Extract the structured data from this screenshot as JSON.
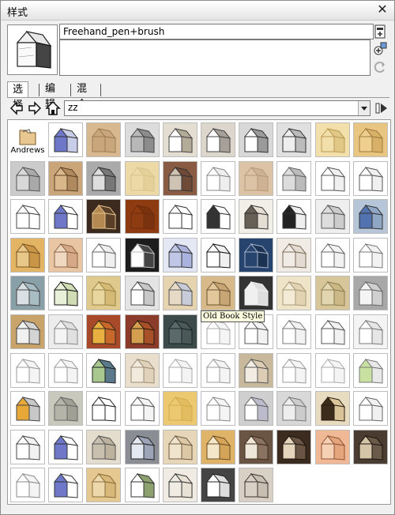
{
  "window": {
    "title": "样式",
    "close_glyph": "✕"
  },
  "style": {
    "name": "Freehand_pen+brush",
    "description": ""
  },
  "tabs": [
    {
      "label": "选择",
      "active": true
    },
    {
      "label": "编辑",
      "active": false
    },
    {
      "label": "混合",
      "active": false
    }
  ],
  "navigation": {
    "library": "zz"
  },
  "grid": {
    "columns": 10,
    "items": [
      {
        "kind": "folder",
        "label": "Andrews"
      },
      {
        "bg": "#ffffff",
        "house": "#6e77c8",
        "line": "#333333",
        "shade": "#c8cde8"
      },
      {
        "bg": "#d8b98f",
        "house": "#c9a77a",
        "line": "#9c7c56",
        "shade": "#c9a77a"
      },
      {
        "bg": "#dcdcdc",
        "house": "#b8b8b8",
        "line": "#444444",
        "shade": "#8c8c8c"
      },
      {
        "bg": "#e3ddd2",
        "house": "#ffffff",
        "line": "#444444",
        "shade": "#b4aa98"
      },
      {
        "bg": "#dcd6cc",
        "house": "#ffffff",
        "line": "#444444",
        "shade": "#a7a099"
      },
      {
        "bg": "#d8d8d8",
        "house": "#ffffff",
        "line": "#333333",
        "shade": "#9a9a9a"
      },
      {
        "bg": "#e0e0e0",
        "house": "#eeeeee",
        "line": "#333333",
        "shade": "#bbbbbb"
      },
      {
        "bg": "#f3dfa9",
        "house": "#f3dfa9",
        "line": "#b89a56",
        "shade": "#e2c886"
      },
      {
        "bg": "#e8c580",
        "house": "#efcf8f",
        "line": "#9c7a3c",
        "shade": "#d8b068"
      },
      {
        "bg": "#cbcbcb",
        "house": "#d8d8d8",
        "line": "#555555",
        "shade": "#a9a9a9"
      },
      {
        "bg": "#caa57a",
        "house": "#d9b78b",
        "line": "#5c4126",
        "shade": "#b08a5e"
      },
      {
        "bg": "#aaaaaa",
        "house": "#dddddd",
        "line": "#333333",
        "shade": "#777777"
      },
      {
        "bg": "#ecd9a6",
        "house": "#ecd9a6",
        "line": "#d8c48f",
        "shade": "#e4d098"
      },
      {
        "bg": "#8a5b43",
        "house": "#cfc3b3",
        "line": "#333333",
        "shade": "#6f4a37"
      },
      {
        "bg": "#ffffff",
        "house": "#ffffff",
        "line": "#888888",
        "shade": "#eeeeee"
      },
      {
        "bg": "#dcc3a5",
        "house": "#dcc3a5",
        "line": "#b89a7c",
        "shade": "#cdb293"
      },
      {
        "bg": "#ffffff",
        "house": "#dcdcdc",
        "line": "#666666",
        "shade": "#bbbbbb"
      },
      {
        "bg": "#ffffff",
        "house": "#ffffff",
        "line": "#555555",
        "shade": "#f0f0f0"
      },
      {
        "bg": "#ffffff",
        "house": "#ffffff",
        "line": "#555555",
        "shade": "#f0f0f0"
      },
      {
        "bg": "#ffffff",
        "house": "#ffffff",
        "line": "#444444",
        "shade": "#ffffff"
      },
      {
        "bg": "#ffffff",
        "house": "#6e77c8",
        "line": "#333333",
        "shade": "#ffffff"
      },
      {
        "bg": "#3b2a1d",
        "house": "#b58a52",
        "line": "#e0c08a",
        "shade": "#5a3f28"
      },
      {
        "bg": "#8f3b12",
        "house": "#8f3b12",
        "line": "#6e2c0c",
        "shade": "#7a320f"
      },
      {
        "bg": "#ffffff",
        "house": "#ffffff",
        "line": "#333333",
        "shade": "#ffffff"
      },
      {
        "bg": "#ffffff",
        "house": "#333333",
        "line": "#333333",
        "shade": "#ffffff"
      },
      {
        "bg": "#f2efe9",
        "house": "#665f55",
        "line": "#333333",
        "shade": "#e4ded2"
      },
      {
        "bg": "#ffffff",
        "house": "#222222",
        "line": "#333333",
        "shade": "#eeeeee"
      },
      {
        "bg": "#efefef",
        "house": "#dddddd",
        "line": "#555555",
        "shade": "#cccccc"
      },
      {
        "bg": "#b6c6d8",
        "house": "#5273b0",
        "line": "#333333",
        "shade": "#8fa6c4"
      },
      {
        "bg": "#e2b463",
        "house": "#e8c889",
        "line": "#7a5524",
        "shade": "#c99648"
      },
      {
        "bg": "#e9c5a4",
        "house": "#f0d7bf",
        "line": "#8c6547",
        "shade": "#d5a987"
      },
      {
        "bg": "#ffffff",
        "house": "#ffffff",
        "line": "#666666",
        "shade": "#f0f0f0"
      },
      {
        "bg": "#1c1c1c",
        "house": "#ffffff",
        "line": "#bbbbbb",
        "shade": "#444444"
      },
      {
        "bg": "#e4e8f4",
        "house": "#c0c7e6",
        "line": "#333333",
        "shade": "#aab3de"
      },
      {
        "bg": "#ffffff",
        "house": "#ffffff",
        "line": "#111111",
        "shade": "#f0f0f0"
      },
      {
        "bg": "#27446e",
        "house": "#27446e",
        "line": "#a8b4c8",
        "shade": "#1b3252"
      },
      {
        "bg": "#f0ebe4",
        "house": "#f0ebe4",
        "line": "#7a6a58",
        "shade": "#e4dcd2"
      },
      {
        "bg": "#ffffff",
        "house": "#ffffff",
        "line": "#666666",
        "shade": "#f2f2f2"
      },
      {
        "bg": "#ffffff",
        "house": "#ffffff",
        "line": "#777777",
        "shade": "#f2f2f2"
      },
      {
        "bg": "#8aa0a8",
        "house": "#d8e0e4",
        "line": "#444444",
        "shade": "#a8bcc4"
      },
      {
        "bg": "#ffffff",
        "house": "#e8f0d8",
        "line": "#111111",
        "shade": "#cfdcb4"
      },
      {
        "bg": "#e0c98c",
        "house": "#e8d69f",
        "line": "#9c8448",
        "shade": "#d4ba74"
      },
      {
        "bg": "#e4e4e4",
        "house": "#ffffff",
        "line": "#444444",
        "shade": "#c8c8c8"
      },
      {
        "bg": "#e6d4b0",
        "house": "#e6d9c6",
        "line": "#555555",
        "shade": "#c8ccd8"
      },
      {
        "bg": "#d8b98a",
        "house": "#e2c79a",
        "line": "#6c5434",
        "shade": "#c8a574"
      },
      {
        "bg": "#333333",
        "house": "#f0f0f0",
        "line": "#f0f0f0",
        "shade": "#dddddd"
      },
      {
        "bg": "#efe4c8",
        "house": "#f3ebd6",
        "line": "#a89878",
        "shade": "#e2d4b2"
      },
      {
        "bg": "#d6c69a",
        "house": "#e2d6b0",
        "line": "#8c7c50",
        "shade": "#cbb886"
      },
      {
        "bg": "#a8a8a8",
        "house": "#f4f4f4",
        "line": "#666666",
        "shade": "#d0d0d0"
      },
      {
        "bg": "#c8a46a",
        "house": "#f0f0f0",
        "line": "#444444",
        "shade": "#d4d4d4"
      },
      {
        "bg": "#ececec",
        "house": "#f4f4f4",
        "line": "#888888",
        "shade": "#e0e0e0"
      },
      {
        "bg": "#a84a2a",
        "house": "#e8b040",
        "line": "#3c2c1c",
        "shade": "#c8682a"
      },
      {
        "bg": "#8c3a2a",
        "house": "#d4a050",
        "line": "#2c1c10",
        "shade": "#a85028"
      },
      {
        "bg": "#3c4a4a",
        "house": "#5a6a6a",
        "line": "#1c2424",
        "shade": "#4a5858"
      },
      {
        "bg": "#ffffff",
        "house": "#ffffff",
        "line": "#aaaaaa",
        "shade": "#f4f4f4"
      },
      {
        "bg": "#ffffff",
        "house": "#ffffff",
        "line": "#555555",
        "shade": "#f2f2f2"
      },
      {
        "bg": "#ffffff",
        "house": "#ffffff",
        "line": "#777777",
        "shade": "#f2f2f2"
      },
      {
        "bg": "#ffffff",
        "house": "#ffffff",
        "line": "#555555",
        "shade": "#f2f2f2"
      },
      {
        "bg": "#f4f4f4",
        "house": "#ffffff",
        "line": "#777777",
        "shade": "#e6e6e6"
      },
      {
        "bg": "#ffffff",
        "house": "#ffffff",
        "line": "#999999",
        "shade": "#f4f4f4"
      },
      {
        "bg": "#ffffff",
        "house": "#ffffff",
        "line": "#999999",
        "shade": "#f4f4f4"
      },
      {
        "bg": "#ffffff",
        "house": "#a8c890",
        "line": "#222222",
        "shade": "#5a7a8c"
      },
      {
        "bg": "#eadfcc",
        "house": "#f2eadc",
        "line": "#9c8c74",
        "shade": "#e0d2ba"
      },
      {
        "bg": "#ffffff",
        "house": "#ffffff",
        "line": "#aaaaaa",
        "shade": "#f4f4f4"
      },
      {
        "bg": "#ffffff",
        "house": "#ffffff",
        "line": "#999999",
        "shade": "#f4f4f4"
      },
      {
        "bg": "#c8b89c",
        "house": "#f2ece2",
        "line": "#555555",
        "shade": "#dccdb4"
      },
      {
        "bg": "#ffffff",
        "house": "#ffffff",
        "line": "#999999",
        "shade": "#f4f4f4"
      },
      {
        "bg": "#ffffff",
        "house": "#ffffff",
        "line": "#aaaaaa",
        "shade": "#f4f4f4"
      },
      {
        "bg": "#ffffff",
        "house": "#c8e0a0",
        "line": "#777777",
        "shade": "#e8e8e8"
      },
      {
        "bg": "#ffffff",
        "house": "#e8a838",
        "line": "#444444",
        "shade": "#c8c8c8"
      },
      {
        "bg": "#c8c8bc",
        "house": "#b4b4a8",
        "line": "#666666",
        "shade": "#a0a094"
      },
      {
        "bg": "#ffffff",
        "house": "#ffffff",
        "line": "#222222",
        "shade": "#ffffff"
      },
      {
        "bg": "#ffffff",
        "house": "#ffffff",
        "line": "#555555",
        "shade": "#f4f4f4"
      },
      {
        "bg": "#ecc870",
        "house": "#ecc870",
        "line": "#d4ac50",
        "shade": "#e4bc60"
      },
      {
        "bg": "#ffffff",
        "house": "#ffffff",
        "line": "#888888",
        "shade": "#f4f4f4"
      },
      {
        "bg": "#cfcfcf",
        "house": "#ffffff",
        "line": "#666666",
        "shade": "#bbbbcc"
      },
      {
        "bg": "#d8d8d8",
        "house": "#eeeeee",
        "line": "#777777",
        "shade": "#cccccc"
      },
      {
        "bg": "#e8dcc0",
        "house": "#3c2c1c",
        "line": "#2c1c10",
        "shade": "#d8c498"
      },
      {
        "bg": "#ffffff",
        "house": "#ffffff",
        "line": "#666666",
        "shade": "#f0f0f0"
      },
      {
        "bg": "#ffffff",
        "house": "#ffffff",
        "line": "#444444",
        "shade": "#f2f2f2"
      },
      {
        "bg": "#ffffff",
        "house": "#6e77c8",
        "line": "#333333",
        "shade": "#ffffff"
      },
      {
        "bg": "#e4dccc",
        "house": "#c8bfae",
        "line": "#555555",
        "shade": "#bcb29e"
      },
      {
        "bg": "#8a8e94",
        "house": "#e4e8f0",
        "line": "#222222",
        "shade": "#9ca4b8"
      },
      {
        "bg": "#e8d6b8",
        "house": "#f0e4cc",
        "line": "#6c5a44",
        "shade": "#dcc8a4"
      },
      {
        "bg": "#e0b468",
        "house": "#f4e6c8",
        "line": "#6a4c24",
        "shade": "#d4a458"
      },
      {
        "bg": "#6a5444",
        "house": "#eee6d8",
        "line": "#3c2c1c",
        "shade": "#8a7260"
      },
      {
        "bg": "#3c2c20",
        "house": "#e4d4bc",
        "line": "#1c140c",
        "shade": "#6a5444"
      },
      {
        "bg": "#f0b894",
        "house": "#f6d0b4",
        "line": "#8c5434",
        "shade": "#e4a47c"
      },
      {
        "bg": "#4a3c30",
        "house": "#d4c4a8",
        "line": "#1c140c",
        "shade": "#6a5a4a"
      },
      {
        "bg": "#ffffff",
        "house": "#ffffff",
        "line": "#888888",
        "shade": "#f4f4f4"
      },
      {
        "bg": "#ffffff",
        "house": "#6e77c8",
        "line": "#333333",
        "shade": "#ffffff"
      },
      {
        "bg": "#e4c890",
        "house": "#ecd8aa",
        "line": "#8c6c3c",
        "shade": "#d8b878"
      },
      {
        "bg": "#ffffff",
        "house": "#ffffff",
        "line": "#333333",
        "shade": "#8ca070"
      },
      {
        "bg": "#f0ece4",
        "house": "#f0ece4",
        "line": "#333333",
        "shade": "#e8e2d6"
      },
      {
        "bg": "#444444",
        "house": "#ffffff",
        "line": "#222222",
        "shade": "#dddddd"
      },
      {
        "bg": "#d8d0c4",
        "house": "#d8d0c4",
        "line": "#3c3430",
        "shade": "#c8bfb2"
      }
    ]
  },
  "tooltip": {
    "text": "Old Book Style"
  }
}
